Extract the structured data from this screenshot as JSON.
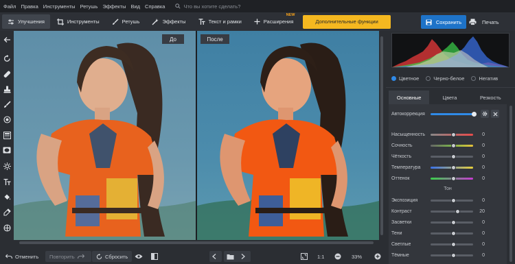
{
  "menu": {
    "items": [
      "Файл",
      "Правка",
      "Инструменты",
      "Ретушь",
      "Эффекты",
      "Вид",
      "Справка"
    ],
    "search_placeholder": "Что вы хотите сделать?"
  },
  "toolbar": {
    "tabs": [
      {
        "label": "Улучшения",
        "active": true
      },
      {
        "label": "Инструменты"
      },
      {
        "label": "Ретушь"
      },
      {
        "label": "Эффекты"
      },
      {
        "label": "Текст и рамки"
      },
      {
        "label": "Расширения",
        "badge": "NEW"
      }
    ],
    "extra_label": "Дополнительные функции",
    "save_label": "Сохранить",
    "print_label": "Печать"
  },
  "canvas": {
    "before_label": "До",
    "after_label": "После"
  },
  "bottom": {
    "undo_label": "Отменить",
    "redo_label": "Повторить",
    "reset_label": "Сбросить",
    "fit_label": "1:1",
    "zoom": "33%"
  },
  "panel": {
    "modes": [
      {
        "label": "Цветное",
        "selected": true
      },
      {
        "label": "Черно-белое",
        "selected": false
      },
      {
        "label": "Негатив",
        "selected": false
      }
    ],
    "subtabs": [
      {
        "label": "Основные",
        "active": true
      },
      {
        "label": "Цвета"
      },
      {
        "label": "Резкость"
      }
    ],
    "autocorrect_label": "Автокоррекция",
    "sliders": [
      {
        "label": "Насыщенность",
        "value": "0",
        "level": 0.5
      },
      {
        "label": "Сочность",
        "value": "0",
        "level": 0.5
      },
      {
        "label": "Чёткость",
        "value": "0",
        "level": 0.5
      },
      {
        "label": "Температура",
        "value": "0",
        "level": 0.5
      },
      {
        "label": "Оттенок",
        "value": "0",
        "level": 0.5
      }
    ],
    "tone_title": "Тон",
    "tone_sliders": [
      {
        "label": "Экспозиция",
        "value": "0",
        "level": 0.5
      },
      {
        "label": "Контраст",
        "value": "20",
        "level": 0.6
      },
      {
        "label": "Засветки",
        "value": "0",
        "level": 0.5
      },
      {
        "label": "Тени",
        "value": "0",
        "level": 0.5
      },
      {
        "label": "Светлые",
        "value": "0",
        "level": 0.5
      },
      {
        "label": "Тёмные",
        "value": "0",
        "level": 0.5
      }
    ]
  },
  "colors": {
    "accent": "#2f8ae8",
    "extra_button": "#f5b820",
    "save_button": "#1e73c8",
    "new_badge": "#f7a21b"
  }
}
